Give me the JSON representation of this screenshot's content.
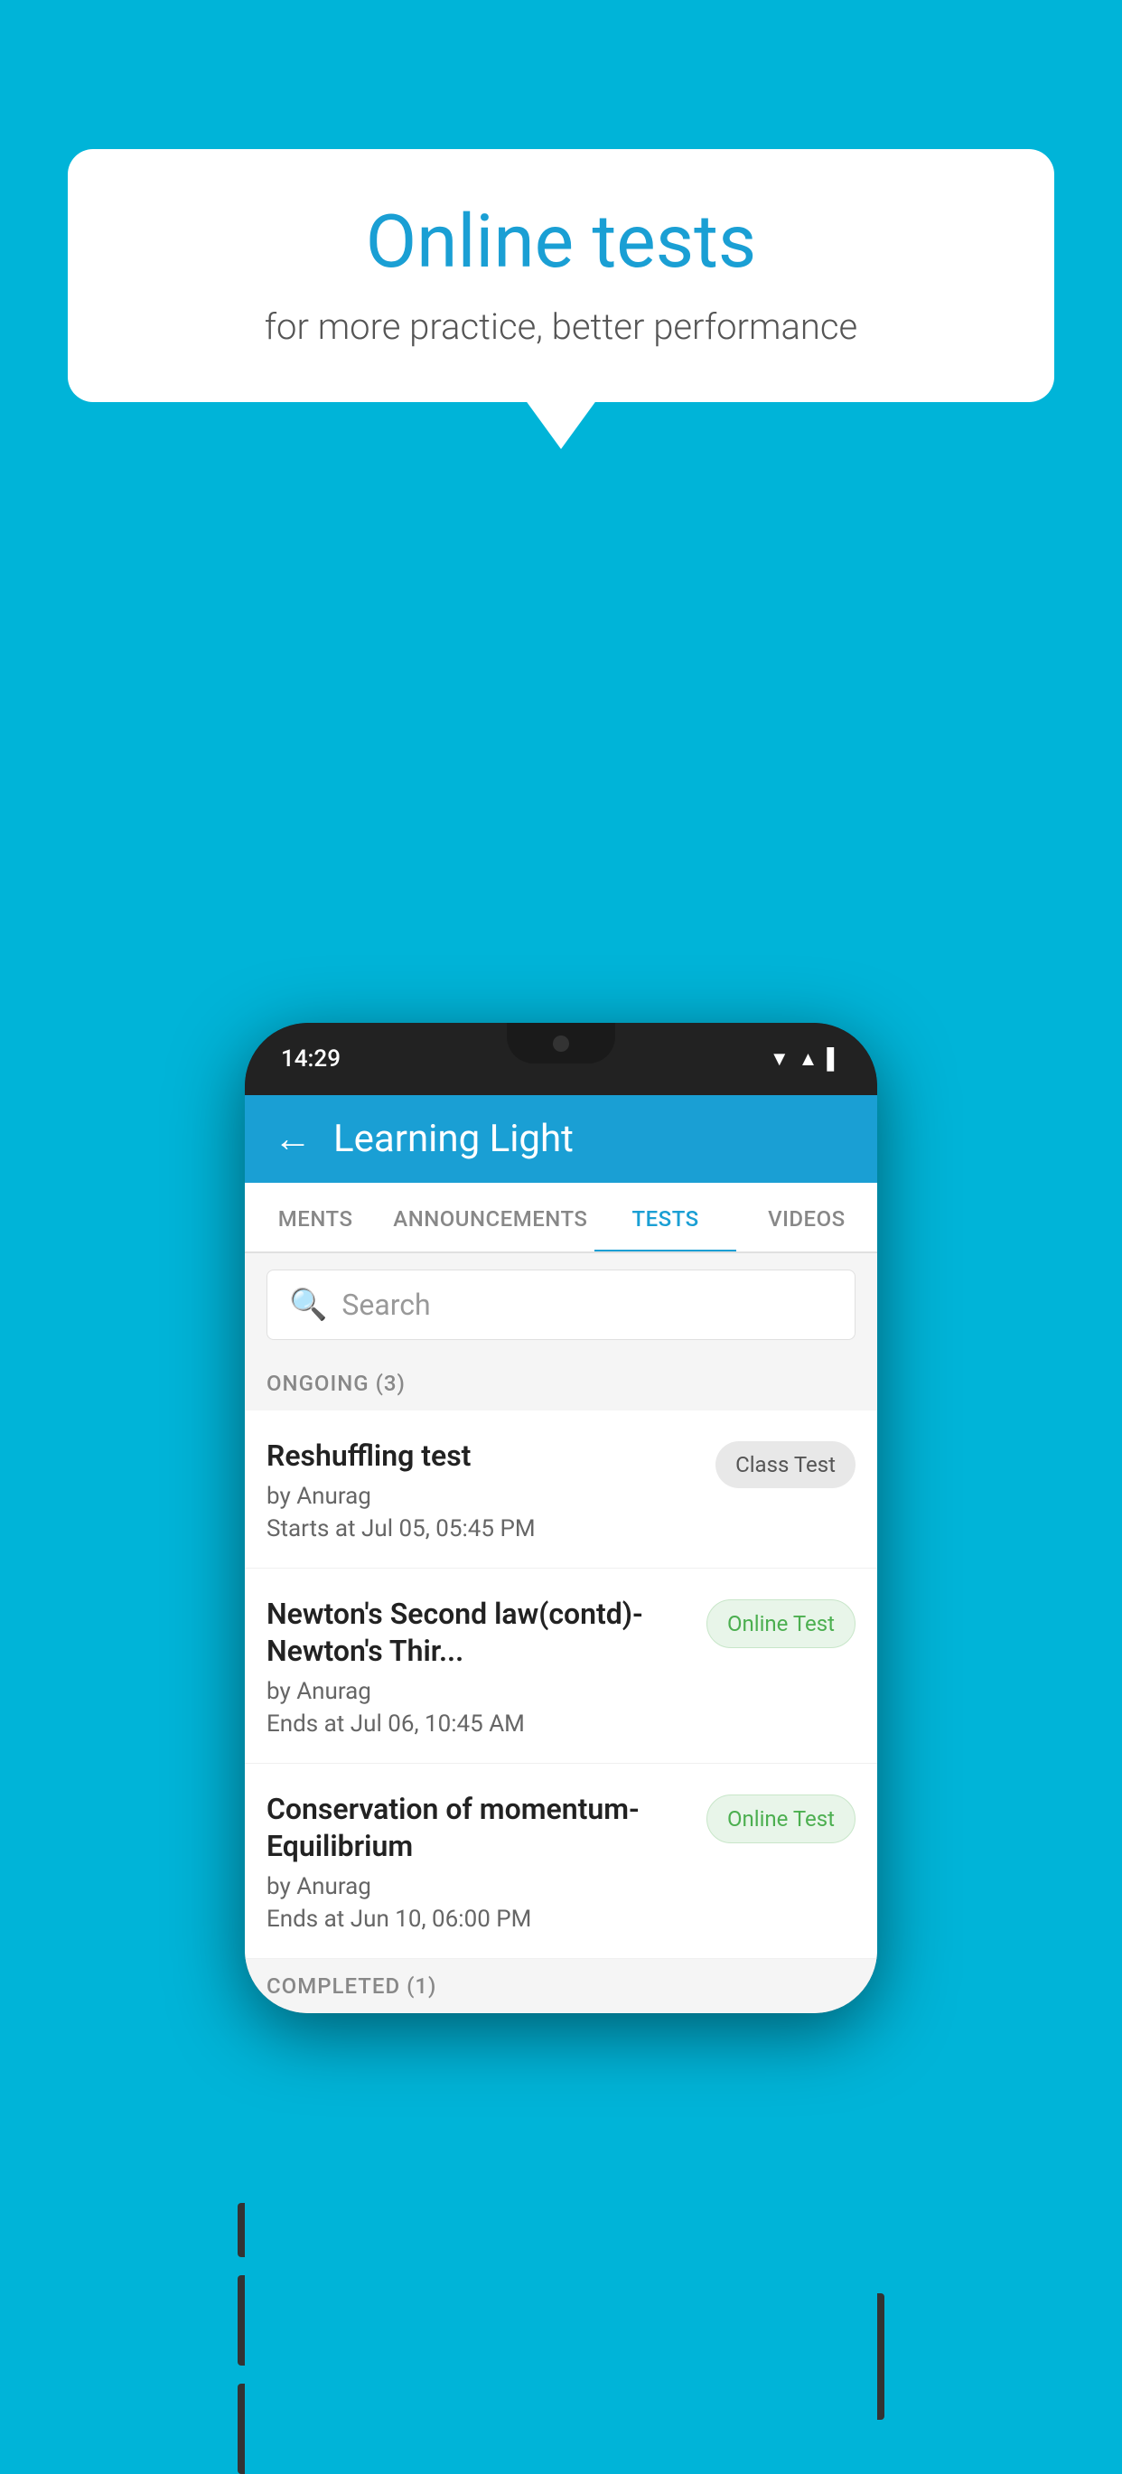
{
  "background": {
    "color": "#00b4d8"
  },
  "speech_bubble": {
    "title": "Online tests",
    "subtitle": "for more practice, better performance"
  },
  "phone": {
    "status_bar": {
      "time": "14:29",
      "icons": [
        "▼",
        "▲",
        "▌"
      ]
    },
    "header": {
      "back_label": "←",
      "title": "Learning Light"
    },
    "tabs": [
      {
        "label": "MENTS",
        "active": false
      },
      {
        "label": "ANNOUNCEMENTS",
        "active": false
      },
      {
        "label": "TESTS",
        "active": true
      },
      {
        "label": "VIDEOS",
        "active": false
      }
    ],
    "search": {
      "placeholder": "Search"
    },
    "ongoing_section": {
      "label": "ONGOING (3)"
    },
    "test_items": [
      {
        "name": "Reshuffling test",
        "author": "by Anurag",
        "time_label": "Starts at",
        "time": "Jul 05, 05:45 PM",
        "badge": "Class Test",
        "badge_type": "class"
      },
      {
        "name": "Newton's Second law(contd)-Newton's Thir...",
        "author": "by Anurag",
        "time_label": "Ends at",
        "time": "Jul 06, 10:45 AM",
        "badge": "Online Test",
        "badge_type": "online"
      },
      {
        "name": "Conservation of momentum-Equilibrium",
        "author": "by Anurag",
        "time_label": "Ends at",
        "time": "Jun 10, 06:00 PM",
        "badge": "Online Test",
        "badge_type": "online"
      }
    ],
    "completed_section": {
      "label": "COMPLETED (1)"
    }
  }
}
